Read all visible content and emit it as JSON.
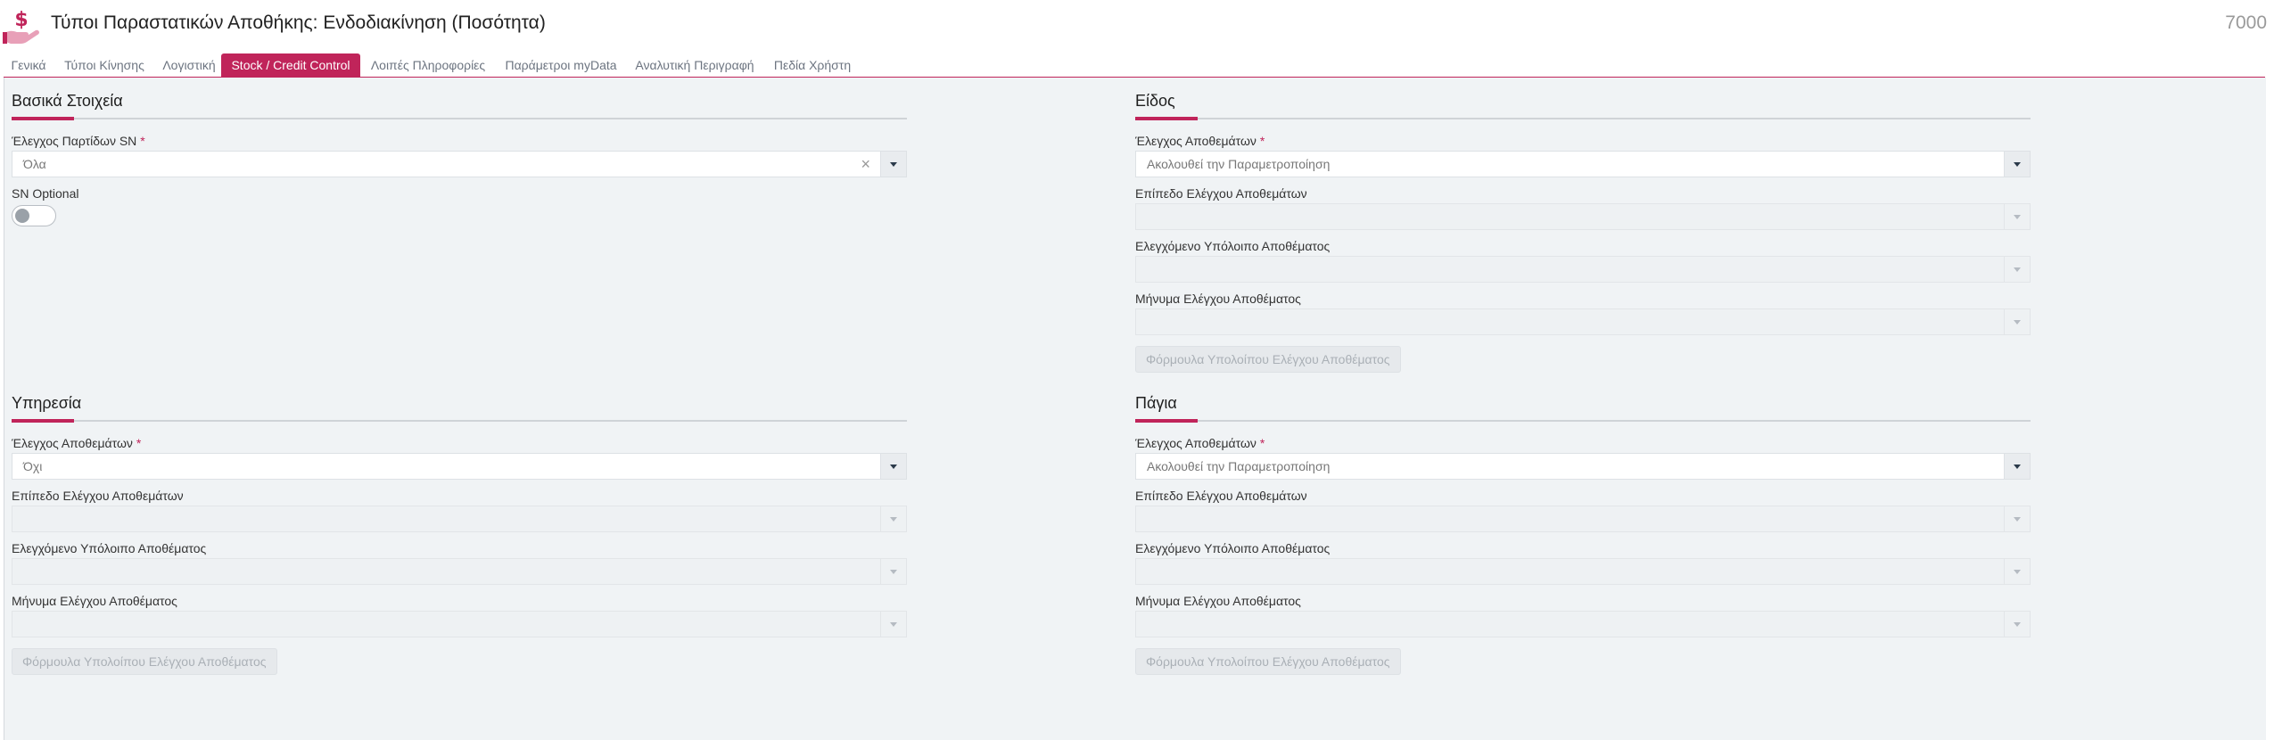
{
  "header": {
    "title": "Τύποι Παραστατικών Αποθήκης: Ενδοδιακίνηση (Ποσότητα)",
    "doc_number": "7000"
  },
  "tabs": [
    {
      "label": "Γενικά"
    },
    {
      "label": "Τύποι Κίνησης"
    },
    {
      "label": "Λογιστική"
    },
    {
      "label": "Stock / Credit Control",
      "active": true
    },
    {
      "label": "Λοιπές Πληροφορίες"
    },
    {
      "label": "Παράμετροι myData"
    },
    {
      "label": "Αναλυτική Περιγραφή"
    },
    {
      "label": "Πεδία Χρήστη"
    }
  ],
  "colors": {
    "accent": "#c0245a",
    "panel_bg": "#f0f3f5"
  },
  "basic": {
    "title": "Βασικά Στοιχεία",
    "sn_batch_label": "Έλεγχος Παρτίδων SN",
    "sn_batch_value": "Όλα",
    "sn_optional_label": "SN Optional",
    "sn_optional_on": false
  },
  "item": {
    "title": "Είδος",
    "stock_control_label": "Έλεγχος Αποθεμάτων",
    "stock_control_value": "Ακολουθεί την Παραμετροποίηση",
    "level_label": "Επίπεδο Ελέγχου Αποθεμάτων",
    "balance_label": "Ελεγχόμενο Υπόλοιπο Αποθέματος",
    "message_label": "Μήνυμα Ελέγχου Αποθέματος",
    "formula_button": "Φόρμουλα Υπολοίπου Ελέγχου Αποθέματος"
  },
  "service": {
    "title": "Υπηρεσία",
    "stock_control_label": "Έλεγχος Αποθεμάτων",
    "stock_control_value": "Όχι",
    "level_label": "Επίπεδο Ελέγχου Αποθεμάτων",
    "balance_label": "Ελεγχόμενο Υπόλοιπο Αποθέματος",
    "message_label": "Μήνυμα Ελέγχου Αποθέματος",
    "formula_button": "Φόρμουλα Υπολοίπου Ελέγχου Αποθέματος"
  },
  "fixed_assets": {
    "title": "Πάγια",
    "stock_control_label": "Έλεγχος Αποθεμάτων",
    "stock_control_value": "Ακολουθεί την Παραμετροποίηση",
    "level_label": "Επίπεδο Ελέγχου Αποθεμάτων",
    "balance_label": "Ελεγχόμενο Υπόλοιπο Αποθέματος",
    "message_label": "Μήνυμα Ελέγχου Αποθέματος",
    "formula_button": "Φόρμουλα Υπολοίπου Ελέγχου Αποθέματος"
  }
}
